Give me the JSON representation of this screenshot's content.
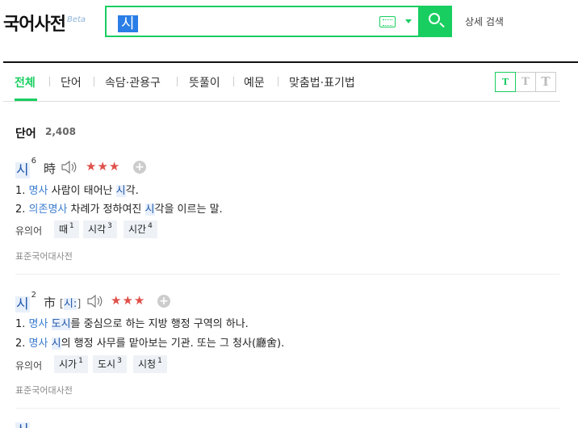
{
  "header": {
    "logo": "국어사전",
    "beta": "Beta",
    "search_value": "시",
    "advanced_search": "상세 검색"
  },
  "tabs": [
    {
      "label": "전체"
    },
    {
      "label": "단어"
    },
    {
      "label": "속담·관용구"
    },
    {
      "label": "뜻풀이"
    },
    {
      "label": "예문"
    },
    {
      "label": "맞춤법·표기법"
    }
  ],
  "font_size_buttons": [
    "T",
    "T",
    "T"
  ],
  "section": {
    "title": "단어",
    "count": "2,408"
  },
  "entries": [
    {
      "word": "시",
      "sup": "6",
      "hanja": "時",
      "pron": "",
      "stars": "★★★",
      "defs": [
        {
          "num": "1.",
          "pos": "명사",
          "pre": "사람이 태어난 ",
          "hl": "시",
          "post": "각."
        },
        {
          "num": "2.",
          "pos": "의존명사",
          "pre": "차례가 정하여진 ",
          "hl": "시",
          "post": "각을 이르는 말."
        }
      ],
      "syn_label": "유의어",
      "synonyms": [
        {
          "w": "때",
          "s": "1"
        },
        {
          "w": "시각",
          "s": "3"
        },
        {
          "w": "시간",
          "s": "4"
        }
      ],
      "source": "표준국어대사전"
    },
    {
      "word": "시",
      "sup": "2",
      "hanja": "市",
      "pron_open": "[",
      "pron": "시:",
      "pron_close": "]",
      "stars": "★★★",
      "defs": [
        {
          "num": "1.",
          "pos": "명사",
          "pre": "",
          "hl": "도시",
          "post": "를 중심으로 하는 지방 행정 구역의 하나."
        },
        {
          "num": "2.",
          "pos": "명사",
          "pre": "",
          "hl": "시",
          "post": "의 행정 사무를 맡아보는 기관. 또는 그 청사(廳舍)."
        }
      ],
      "syn_label": "유의어",
      "synonyms": [
        {
          "w": "시가",
          "s": "1"
        },
        {
          "w": "도시",
          "s": "3"
        },
        {
          "w": "시청",
          "s": "1"
        }
      ],
      "source": "표준국어대사전"
    }
  ],
  "icons": [
    "keyboard-icon",
    "dropdown-arrow-icon",
    "search-icon",
    "speaker-icon",
    "plus-icon"
  ],
  "colors": {
    "accent": "#19ce60",
    "star": "#e0504a",
    "pos": "#3c7ed0",
    "highlight_bg": "#e8f0fc"
  }
}
